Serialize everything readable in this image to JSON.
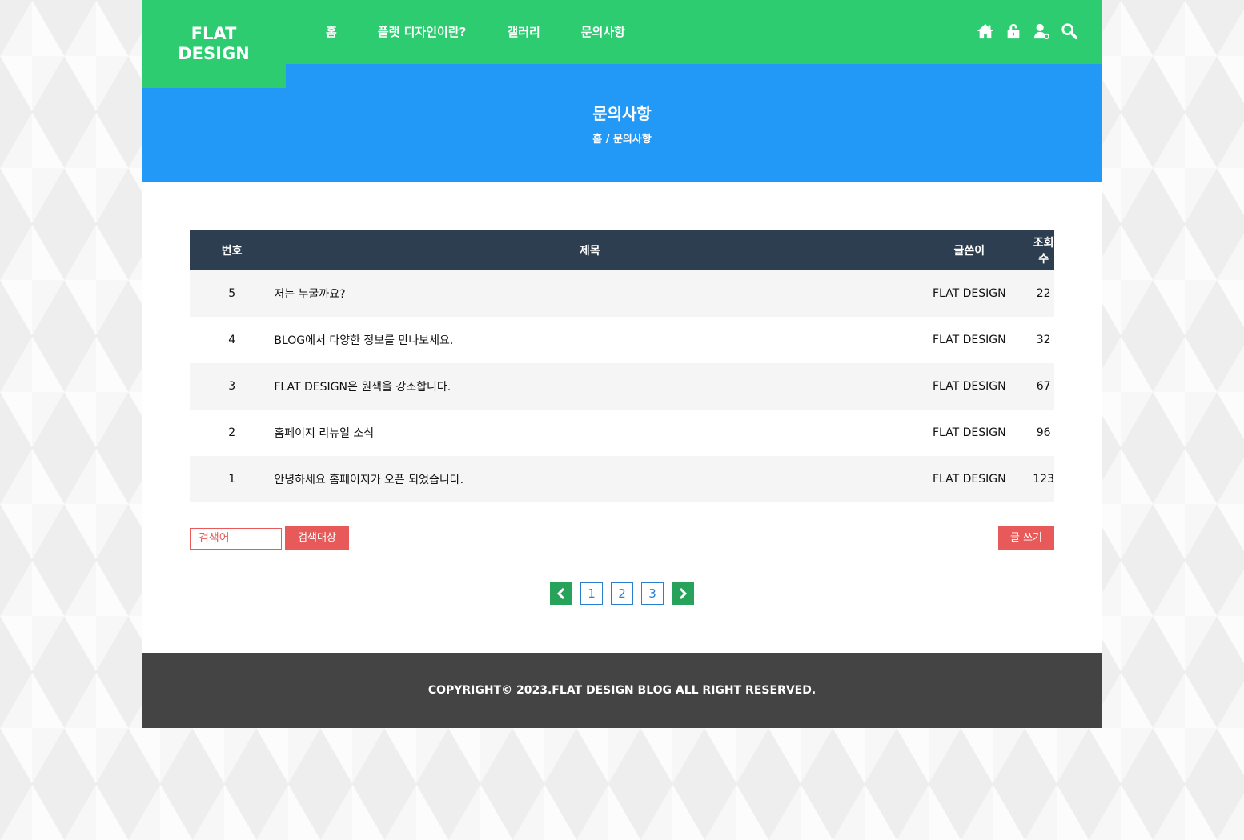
{
  "logo": {
    "line1": "FLAT",
    "line2": "DESIGN"
  },
  "nav": [
    "홈",
    "플랫 디자인이란?",
    "갤러리",
    "문의사항"
  ],
  "header_icons": [
    "home-icon",
    "lock-icon",
    "user-icon",
    "search-icon"
  ],
  "banner": {
    "title": "문의사항",
    "breadcrumb": "홈 / 문의사항"
  },
  "table": {
    "headers": [
      "번호",
      "제목",
      "글쓴이",
      "조회수"
    ],
    "rows": [
      {
        "num": "5",
        "title": "저는 누굴까요?",
        "writer": "FLAT DESIGN",
        "views": "22"
      },
      {
        "num": "4",
        "title": "BLOG에서 다양한 정보를 만나보세요.",
        "writer": "FLAT DESIGN",
        "views": "32"
      },
      {
        "num": "3",
        "title": "FLAT DESIGN은 원색을 강조합니다.",
        "writer": "FLAT DESIGN",
        "views": "67"
      },
      {
        "num": "2",
        "title": "홈페이지 리뉴얼 소식",
        "writer": "FLAT DESIGN",
        "views": "96"
      },
      {
        "num": "1",
        "title": "안녕하세요 홈페이지가 오픈 되었습니다.",
        "writer": "FLAT DESIGN",
        "views": "123"
      }
    ]
  },
  "search": {
    "placeholder": "검색어",
    "button": "검색대상"
  },
  "write_button": "글 쓰기",
  "pagination": {
    "pages": [
      "1",
      "2",
      "3"
    ]
  },
  "footer": {
    "copyright": "COPYRIGHT© 2023.FLAT DESIGN BLOG ALL RIGHT RESERVED."
  },
  "colors": {
    "header": "#2ecc71",
    "banner": "#2299f6",
    "table_head": "#2d3e50",
    "accent": "#e85a5a",
    "footer": "#444444"
  }
}
